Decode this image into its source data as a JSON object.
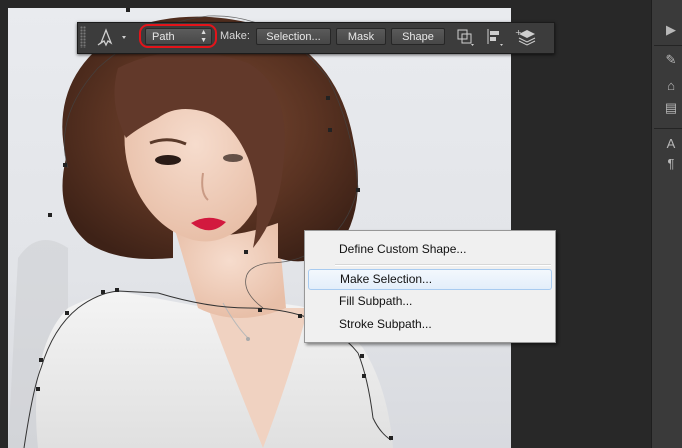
{
  "options_bar": {
    "mode_value": "Path",
    "make_label": "Make:",
    "selection_button": "Selection...",
    "mask_button": "Mask",
    "shape_button": "Shape",
    "highlight_color": "#e3141a"
  },
  "context_menu": {
    "items": [
      {
        "label": "Define Custom Shape..."
      },
      {
        "label": "Make Selection..."
      },
      {
        "label": "Fill Subpath..."
      },
      {
        "label": "Stroke Subpath..."
      }
    ]
  },
  "right_panel": {
    "letter": "A"
  },
  "colors": {
    "workspace": "#282828",
    "menu_hover_border": "#a8cbf0"
  }
}
